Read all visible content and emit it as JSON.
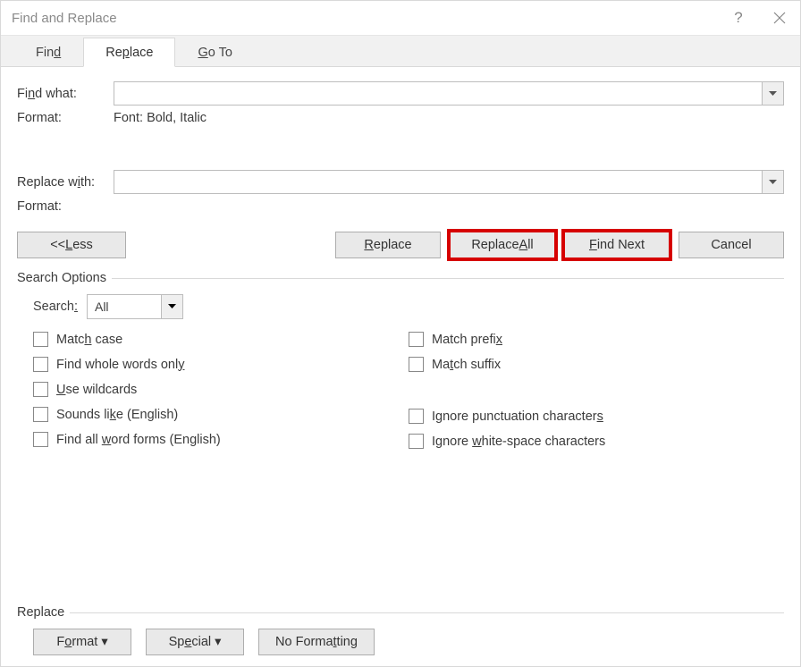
{
  "title": "Find and Replace",
  "tabs": {
    "find": "Find",
    "replace": "Replace",
    "goto": "Go To"
  },
  "labels": {
    "find_what": "Find what:",
    "format": "Format:",
    "replace_with": "Replace with:",
    "format_value_find": "Font: Bold, Italic",
    "format_value_replace": ""
  },
  "inputs": {
    "find_what": "",
    "replace_with": ""
  },
  "buttons": {
    "less": "<< Less",
    "replace": "Replace",
    "replace_all": "Replace All",
    "find_next": "Find Next",
    "cancel": "Cancel",
    "format": "Format",
    "special": "Special",
    "no_formatting": "No Formatting"
  },
  "sections": {
    "search_options": "Search Options",
    "replace": "Replace"
  },
  "search": {
    "label": "Search:",
    "value": "All"
  },
  "checks": {
    "match_case": "Match case",
    "whole_words": "Find whole words only",
    "wildcards": "Use wildcards",
    "sounds_like": "Sounds like (English)",
    "word_forms": "Find all word forms (English)",
    "match_prefix": "Match prefix",
    "match_suffix": "Match suffix",
    "ignore_punct": "Ignore punctuation characters",
    "ignore_ws": "Ignore white-space characters"
  }
}
